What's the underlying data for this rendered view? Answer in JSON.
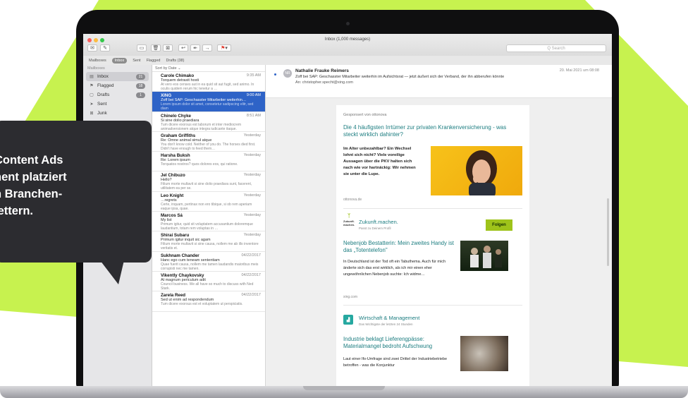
{
  "colors": {
    "accent": "#2e63c7",
    "green": "#c7f24f",
    "teal": "#1c7d80",
    "follow_green": "#9ec31a"
  },
  "window": {
    "title": "Inbox (1,000 messages)",
    "search_placeholder": "Q Search"
  },
  "favorites": {
    "items": [
      "Mailboxes",
      "Inbox",
      "Sent",
      "Flagged",
      "Drafts (38)"
    ],
    "active": "Inbox"
  },
  "sidebar": {
    "header": "Mailboxes",
    "items": [
      {
        "label": "Inbox",
        "icon": "inbox-icon",
        "badge": "21"
      },
      {
        "label": "Flagged",
        "icon": "flag-icon",
        "badge": "18"
      },
      {
        "label": "Drafts",
        "icon": "draft-icon",
        "badge": "1"
      },
      {
        "label": "Sent",
        "icon": "send-icon",
        "badge": ""
      },
      {
        "label": "Junk",
        "icon": "junk-icon",
        "badge": ""
      }
    ]
  },
  "message_list": {
    "sort_label": "Sort by Date ⌄",
    "messages": [
      {
        "from": "Carole Chimako",
        "date": "9:35 AM",
        "subject": "Torquem detraxit hosti",
        "preview": "At vero eos censes aut in ea quid sit aut fugit, sed animo. In oculis quidem rerum hic tenetur a …"
      },
      {
        "from": "XING",
        "date": "9:00 AM",
        "subject": "Zoff bei SAP: Geschasster Mitarbeiter weiterhin…",
        "preview": "Lorem ipsum dolor sit amet, consetetur sadipscing elitr, sed diam",
        "selected": true
      },
      {
        "from": "Chinelo Chyke",
        "date": "8:51 AM",
        "subject": "Si sine dolio praediara",
        "preview": "Tum dicere exorsus est laborum et inter mediocrem animadversionem atque integra iudicante itaque."
      },
      {
        "from": "Graham Griffiths",
        "date": "Yesterday",
        "subject": "Re: Omne animal simul atque",
        "preview": "You don't know cold. Neither of you do. The horses died first. Didn't have enough to feed them…"
      },
      {
        "from": "Harsha Buksh",
        "date": "Yesterday",
        "subject": "Re: Lorem ipsum",
        "preview": "Torquatos nostros? quos dolores eos, qui ratione."
      },
      {
        "from": "Jel Chibuzo",
        "date": "Yesterday",
        "subject": "Hello?",
        "preview": "Filium morte multavit si sine dolio praediara sunt, facerent, utilitatem ea per se."
      },
      {
        "from": "Leo Knight",
        "date": "Yesterday",
        "subject": "…regrets",
        "preview": "Certe, inquam, pertinax non ero tibique, si ob rem aperiam eaque ipsa, quae."
      },
      {
        "from": "Marcos Sá",
        "date": "Yesterday",
        "subject": "My list",
        "preview": "Primum igitur, quid sit voluptatem accusantium doloremque laudantium, totam rem voluptas in …"
      },
      {
        "from": "Shirai Subaru",
        "date": "Yesterday",
        "subject": "Primum igitur inquit sic agam",
        "preview": "Filium morte multavit si sine causa, nollem me ab illo inventore veritatis et."
      },
      {
        "from": "Sukhnam Chander",
        "date": "04/22/2017",
        "subject": "Hanc ego cum teneam sententiam",
        "preview": "Quae fuerit causa, nollem me tamen laudandis maioribus meis corrupisti nec me tamen."
      },
      {
        "from": "Vikently Chaykovsky",
        "date": "04/22/2017",
        "subject": "At magnum periculum adit",
        "preview": "Council business. We all have so much to discuss with Ned Stark."
      },
      {
        "from": "Zarela Reed",
        "date": "04/22/2017",
        "subject": "Sed ut enim ad respondendum",
        "preview": "Tum dicere exorsus est et voluptatem ut perspiciatis."
      }
    ]
  },
  "reading_pane": {
    "avatar": "NR",
    "from": "Nathalie Frauke Reimers",
    "date": "20. Mai 2021 um 08:08",
    "subject": "Zoff bei SAP: Geschasster Mitarbeiter weiterhin im Aufsichtsrat — jetzt äußert sich der Verband, der ihn abberufen könnte",
    "to": "An:  christopher.specht@xing.com",
    "newsletter": {
      "sponsored": "Gesponsert von ottonova",
      "ad_title": "Die 4 häufigsten Irrtümer zur privaten Krankenversicherung - was steckt wirklich dahinter?",
      "ad_text": "Im Alter unbezahlbar? Ein Wechsel lohnt sich nicht? Viele voreilige Aussagen über die PKV halten sich nach wie vor hartnäckig: Wir nehmen sie unter die Lupe.",
      "ad_source": "ottonova.de",
      "zk_logo": "Zukunft.\nmachen.",
      "zk_name": "Zukunft.machen.",
      "zk_sub": "Passt zu Deinem Profil",
      "follow": "Folgen",
      "a1_title": "Nebenjob Bestatterin: Mein zweites Handy ist das „Totentelefon\"",
      "a1_text": "In Deutschland ist der Tod oft ein Tabuthema. Auch für mich änderte sich das erst wirklich, als ich mir einen eher ungewöhnlichen Nebenjob suchte: Ich widme…",
      "a1_source": "xing.com",
      "wm_name": "Wirtschaft & Management",
      "wm_sub": "Das Wichtigste der letzten 24 Stunden",
      "a2_title": "Industrie beklagt Lieferengpässe: Materialmangel bedroht Aufschwung",
      "a2_text": "Laut einer Ifo-Umfrage sind zwei Drittel der Industriebetriebe betroffen - was die Konjunktur"
    }
  },
  "callout": {
    "lines": [
      "Content Ads",
      "nent platziert",
      "n Branchen-",
      "lettern."
    ]
  }
}
